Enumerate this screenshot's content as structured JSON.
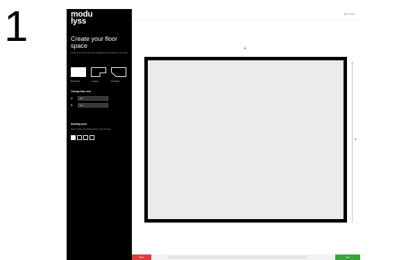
{
  "step": {
    "number": "1"
  },
  "sidebar": {
    "logo": [
      "modu",
      "lyss"
    ],
    "title": "Create your floor space",
    "description": "Select your room type and change the dimensions of the floor.",
    "shapes": [
      {
        "label": "Rectangle",
        "active": true
      },
      {
        "label": "L-shape",
        "active": false
      },
      {
        "label": "Pentagon",
        "active": false
      }
    ],
    "size_heading": "Change floor size",
    "size_a": {
      "key": "A",
      "value": "500"
    },
    "size_b": {
      "key": "B",
      "value": "600"
    },
    "starting_point": {
      "heading": "Starting point",
      "description": "Select where the laying pattern should start."
    }
  },
  "topbar": {
    "links": "Save  |  Help"
  },
  "canvas": {
    "dim_b_label": "B",
    "dim_a_label": "A"
  },
  "bottombar": {
    "back_label": "Back",
    "info_text": "",
    "next_label": "Next"
  },
  "colors": {
    "sidebar_bg": "#000000",
    "room_fill": "#ebebeb",
    "back_button": "#e33b3b",
    "next_button": "#3aa43a"
  }
}
